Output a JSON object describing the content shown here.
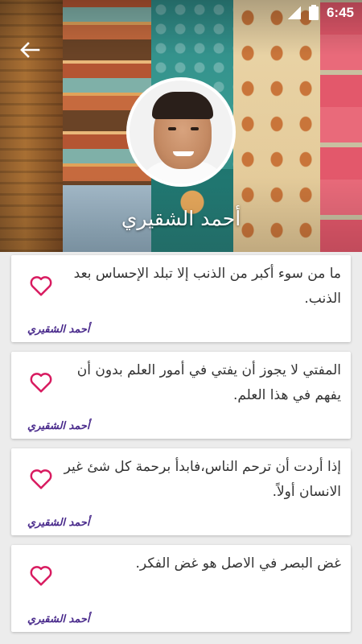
{
  "status_bar": {
    "time": "6:45"
  },
  "header": {
    "author_name": "أحمد الشقيري"
  },
  "quotes": [
    {
      "text": "ما من سوء أكبر من الذنب إلا تبلد الإحساس بعد الذنب.",
      "author": "أحمد الشقيري"
    },
    {
      "text": "المفتي لا يجوز أن يفتي في أمور العلم بدون أن يفهم في هذا العلم.",
      "author": "أحمد الشقيري"
    },
    {
      "text": "إذا أردت أن ترحم الناس،فابدأ برحمة كل شئ غير الانسان أولاً.",
      "author": "أحمد الشقيري"
    },
    {
      "text": "غض البصر في الاصل هو غض الفكر.",
      "author": "أحمد الشقيري"
    }
  ],
  "colors": {
    "heart": "#d81b60",
    "author_link": "#4a2b8c",
    "background": "#ececec"
  },
  "icons": {
    "back": "arrow-back-icon",
    "favorite": "heart-outline-icon"
  }
}
